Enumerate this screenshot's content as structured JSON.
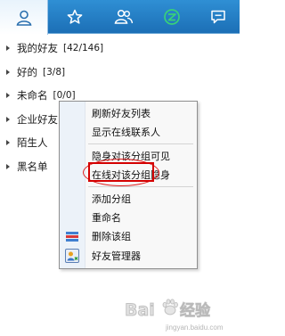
{
  "tabs": [
    {
      "icon": "contact-person-icon",
      "active": true
    },
    {
      "icon": "star-icon",
      "active": false
    },
    {
      "icon": "group-icon",
      "active": false
    },
    {
      "icon": "qzone-icon",
      "active": false
    },
    {
      "icon": "chat-bubble-icon",
      "active": false
    }
  ],
  "groups": [
    {
      "name": "我的好友",
      "count": "[42/146]"
    },
    {
      "name": "好的",
      "count": "[3/8]"
    },
    {
      "name": "未命名",
      "count": "[0/0]"
    },
    {
      "name": "企业好友",
      "count": ""
    },
    {
      "name": "陌生人",
      "count": ""
    },
    {
      "name": "黑名单",
      "count": ""
    }
  ],
  "menu": {
    "items": [
      {
        "label": "刷新好友列表"
      },
      {
        "label": "显示在线联系人"
      },
      {
        "label": "隐身对该分组可见"
      },
      {
        "label": "在线对该分组隐身"
      },
      {
        "label": "添加分组",
        "highlighted": true
      },
      {
        "label": "重命名"
      },
      {
        "label": "删除该组",
        "icon": "delete-group-icon"
      },
      {
        "label": "好友管理器",
        "icon": "friend-manager-icon"
      }
    ]
  },
  "annotation_color": "#d40000",
  "tabbar_color": "#1e74bb",
  "watermark": {
    "text": "Bai du 经验",
    "url": "jingyan.baidu.com"
  }
}
